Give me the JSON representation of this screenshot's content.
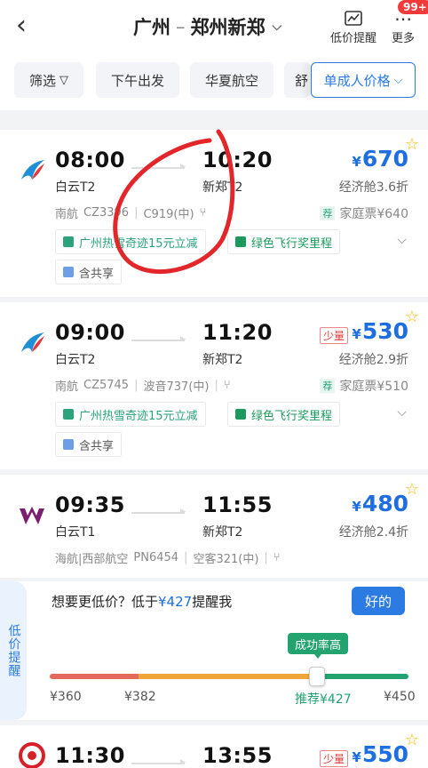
{
  "header": {
    "back_icon": "chevron-left-icon",
    "origin": "广州",
    "dash": "–",
    "destination": "郑州新郑",
    "alert_label": "低价提醒",
    "more_label": "更多",
    "badge": "99+"
  },
  "filters": {
    "filter_label": "筛选",
    "afternoon": "下午出发",
    "airline": "华夏航空",
    "partial": "舒",
    "sort": "单成人价格"
  },
  "flights": [
    {
      "dep_time": "08:00",
      "arr_time": "10:20",
      "dep_airport": "白云T2",
      "arr_airport": "新郑T2",
      "airline": "南航",
      "flight_no": "CZ3396",
      "aircraft": "C919(中)",
      "price": "670",
      "currency": "¥",
      "cabin": "经济舱3.6折",
      "family_tag": "荐",
      "family": "家庭票¥640",
      "promo": "广州热雪奇迹15元立减",
      "green": "绿色飞行奖里程",
      "share": "含共享",
      "few": ""
    },
    {
      "dep_time": "09:00",
      "arr_time": "11:20",
      "dep_airport": "白云T2",
      "arr_airport": "新郑T2",
      "airline": "南航",
      "flight_no": "CZ5745",
      "aircraft": "波音737(中)",
      "price": "530",
      "currency": "¥",
      "cabin": "经济舱2.9折",
      "family_tag": "荐",
      "family": "家庭票¥510",
      "promo": "广州热雪奇迹15元立减",
      "green": "绿色飞行奖里程",
      "share": "含共享",
      "few": "少量"
    },
    {
      "dep_time": "09:35",
      "arr_time": "11:55",
      "dep_airport": "白云T1",
      "arr_airport": "新郑T2",
      "airline": "海航|西部航空",
      "flight_no": "PN6454",
      "aircraft": "空客321(中)",
      "price": "480",
      "currency": "¥",
      "cabin": "经济舱2.4折"
    },
    {
      "dep_time": "11:30",
      "arr_time": "13:55",
      "price": "550",
      "currency": "¥",
      "few": "少量"
    }
  ],
  "price_alert": {
    "side_tab": "低价提醒",
    "question_a": "想要更低价？低于",
    "question_price": "¥427",
    "question_b": "提醒我",
    "ok": "好的",
    "success_rate": "成功率高",
    "ticks": [
      "¥360",
      "¥382",
      "推荐¥427",
      "¥450"
    ],
    "recommended_position": 0.82
  },
  "colors": {
    "accent": "#2b7be3",
    "price": "#1e6ee0",
    "green": "#22a36f",
    "red": "#e03c3c"
  }
}
